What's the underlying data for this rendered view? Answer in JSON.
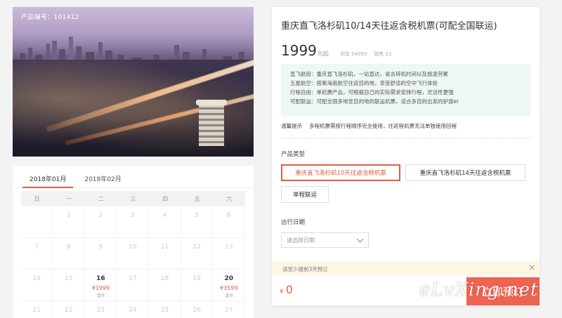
{
  "product": {
    "number_label": "产品编号：101412",
    "title": "重庆直飞洛杉矶10/14天往返含税机票(可配全国联运)",
    "price": "1999",
    "price_unit": "元起",
    "views": "浏览 54093",
    "sales": "销售 22"
  },
  "features": [
    "直飞航班：重庆直飞洛杉矶，一站直达，省去转机时间以及旅途劳累",
    "五星航空：搭乘海南航空往返目的地，享受舒适的空中飞行体验",
    "行程自由：单机票产品，可根据自己的实际需求安排行程，灵活性更强",
    "可配联运：可配全国多地至目的地的联运机票，适合多目的出发的驴游er"
  ],
  "notice": {
    "label": "温馨提示",
    "text": "多程机票需按行程顺序完全使用，往返程机票无法单独使用回程"
  },
  "product_type": {
    "label": "产品类型",
    "options": [
      "重庆直飞洛杉矶10天往返含税机票",
      "重庆直飞洛杉矶14天往返含税机票",
      "单程联运"
    ]
  },
  "departure": {
    "label": "出行日期",
    "placeholder": "请选择日期"
  },
  "tip": "请至少提前3天预订",
  "total": {
    "currency": "¥",
    "amount": "0"
  },
  "book_label": "立即预订",
  "watermark": "eLvXing.net",
  "calendar": {
    "tabs": [
      "2018年01月",
      "2018年02月"
    ],
    "weekdays": [
      "日",
      "一",
      "二",
      "三",
      "四",
      "五",
      "六"
    ],
    "rows": [
      [
        {
          "d": ""
        },
        {
          "d": "1"
        },
        {
          "d": "2"
        },
        {
          "d": "3"
        },
        {
          "d": "4"
        },
        {
          "d": "5"
        },
        {
          "d": "6"
        }
      ],
      [
        {
          "d": "7"
        },
        {
          "d": "8"
        },
        {
          "d": "9"
        },
        {
          "d": "10"
        },
        {
          "d": "11"
        },
        {
          "d": "12"
        },
        {
          "d": "13"
        }
      ],
      [
        {
          "d": "14"
        },
        {
          "d": "15"
        },
        {
          "d": "16",
          "p": "¥1999",
          "s": "余8",
          "on": true
        },
        {
          "d": "17"
        },
        {
          "d": "18"
        },
        {
          "d": "19"
        },
        {
          "d": "20",
          "p": "¥3599",
          "s": "余8",
          "on": true
        }
      ],
      [
        {
          "d": "21"
        },
        {
          "d": "22"
        },
        {
          "d": "23"
        },
        {
          "d": "24"
        },
        {
          "d": "25"
        },
        {
          "d": "26"
        },
        {
          "d": "27"
        }
      ]
    ]
  },
  "colors": {
    "accent": "#e55b45",
    "button": "#f06350",
    "feature_bg": "#eef7f3",
    "tip_bg": "#fdf6e3"
  }
}
